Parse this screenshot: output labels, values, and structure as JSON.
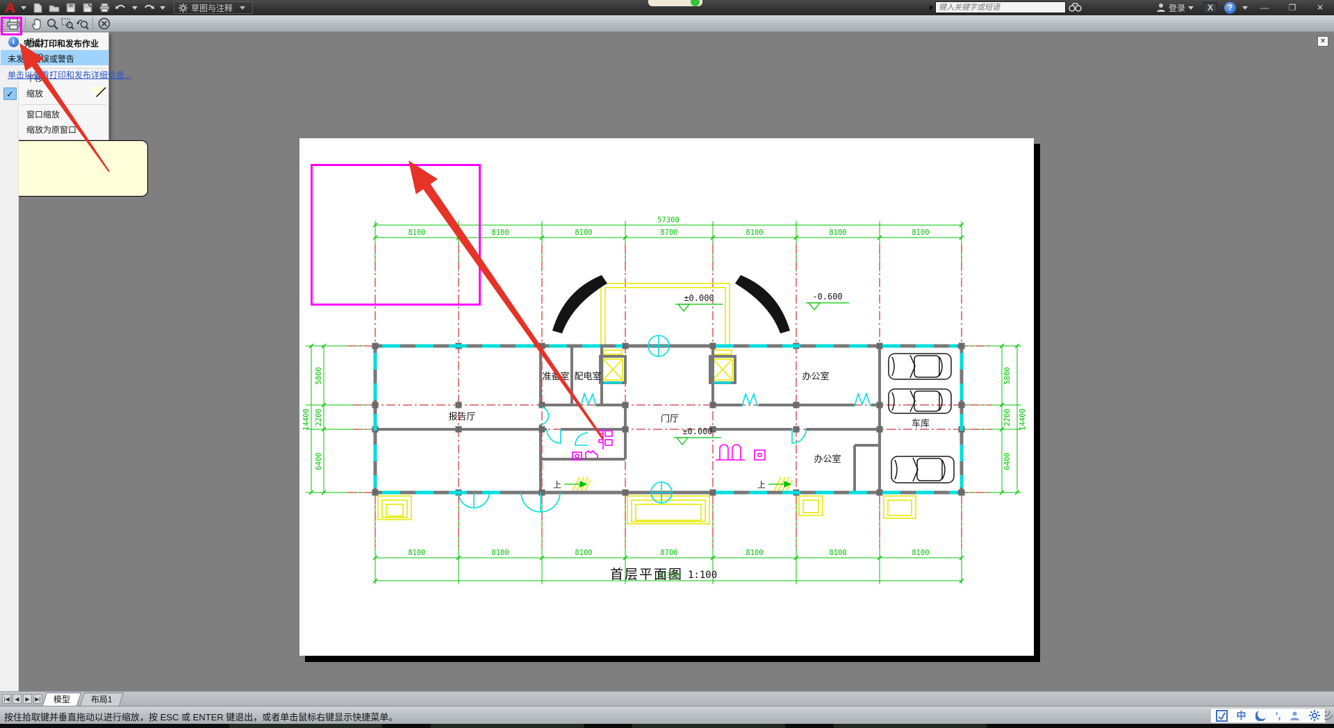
{
  "titlebar": {
    "workspace": "草图与注释",
    "search_placeholder": "键入关键字或短语",
    "login_label": "登录",
    "exchange_label": "X",
    "help_label": "?"
  },
  "menu": {
    "items": [
      {
        "label": "退出"
      },
      {
        "label": "打印"
      },
      {
        "label": "平移"
      },
      {
        "label": "缩放"
      },
      {
        "label": "窗口缩放"
      },
      {
        "label": "缩放为原窗口"
      }
    ],
    "check_glyph": "✓"
  },
  "tabs": {
    "nav": [
      "|◀",
      "◀",
      "▶",
      "▶|"
    ],
    "model": "模型",
    "layout1": "布局1"
  },
  "statusbar": {
    "message": "按住拾取键并垂直拖动以进行缩放，按 ESC 或 ENTER 键退出，或者单击鼠标右键显示快捷菜单。",
    "ime": "中",
    "quote_marks": "’,"
  },
  "notification": {
    "title": "完成打印和发布作业",
    "body": "未发现错误或警告",
    "link": "单击以查看打印和发布详细信息...",
    "close_glyph": "✕",
    "info_glyph": "i"
  },
  "plan": {
    "title": "首层平面图",
    "scale": "1:100",
    "total_width_label": "57300",
    "total_height_label": "14400",
    "bays": [
      "8100",
      "8100",
      "8100",
      "8700",
      "8100",
      "8100",
      "8100"
    ],
    "rows": [
      "5800",
      "2200",
      "6400"
    ],
    "rooms": {
      "lecture": "报告厅",
      "prep": "准备室",
      "power": "配电室",
      "hall": "门厅",
      "office_top": "办公室",
      "garage": "车库",
      "office_bottom": "办公室"
    },
    "elevations": {
      "main": "±0.000",
      "entry": "-0.600",
      "hall": "±0.000"
    },
    "stair_up": "上"
  }
}
